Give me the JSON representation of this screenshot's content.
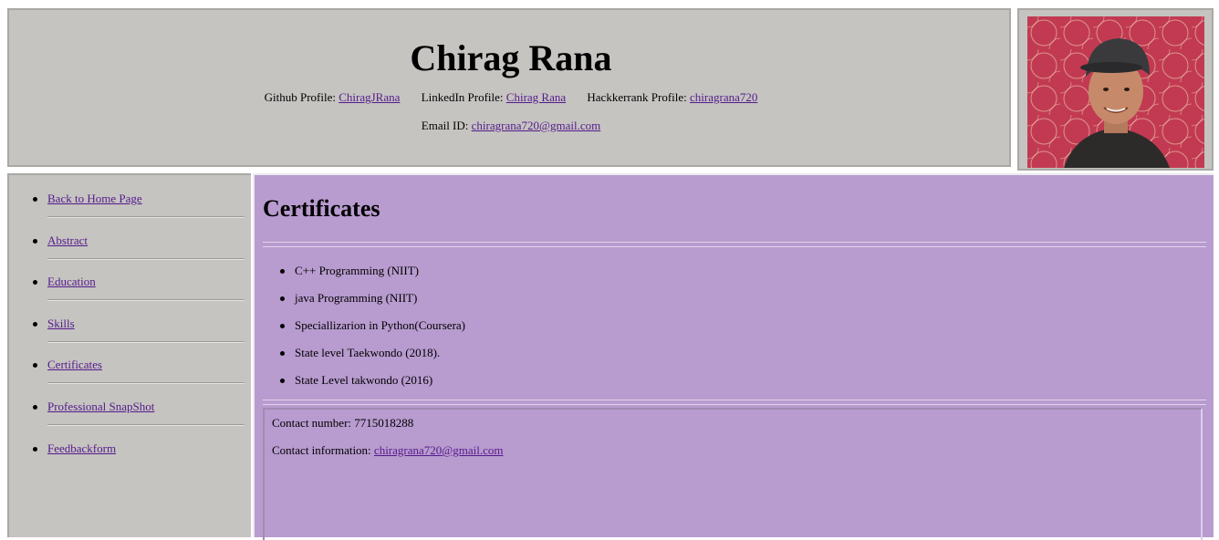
{
  "header": {
    "name": "Chirag Rana",
    "github_label": "Github Profile:",
    "github_link": "ChiragJRana",
    "linkedin_label": "LinkedIn Profile:",
    "linkedin_link": "Chirag Rana",
    "hackerrank_label": "Hackkerrank Profile:",
    "hackerrank_link": "chiragrana720",
    "email_label": "Email ID:",
    "email_link": "chiragrana720@gmail.com"
  },
  "sidebar": {
    "items": [
      {
        "label": "Back to Home Page"
      },
      {
        "label": "Abstract"
      },
      {
        "label": "Education"
      },
      {
        "label": "Skills"
      },
      {
        "label": "Certificates"
      },
      {
        "label": "Professional SnapShot"
      },
      {
        "label": "Feedbackform"
      }
    ]
  },
  "main": {
    "title": "Certificates",
    "certificates": [
      "C++ Programming (NIIT)",
      "java Programming (NIIT)",
      "Speciallizarion in Python(Coursera)",
      "State level Taekwondo (2018).",
      "State Level takwondo (2016)"
    ],
    "contact": {
      "number_label": "Contact number: 7715018288",
      "info_label": "Contact information:",
      "info_link": "chiragrana720@gmail.com"
    }
  },
  "colors": {
    "header_bg": "#c5c4c1",
    "main_bg": "#b89bcf",
    "link": "#551a8b"
  }
}
